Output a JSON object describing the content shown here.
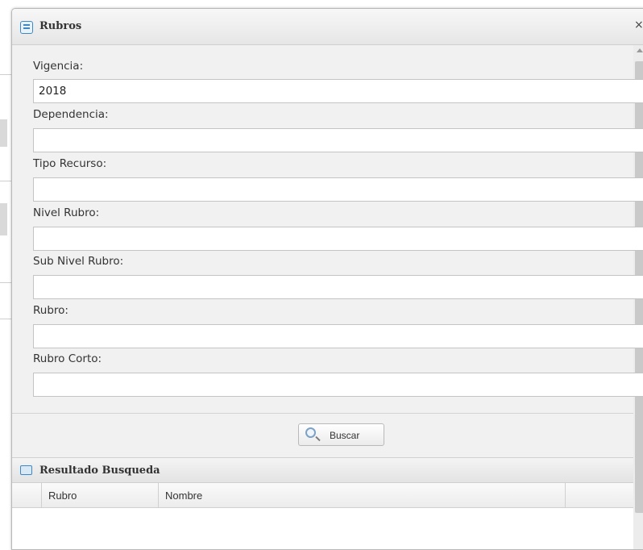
{
  "dialog": {
    "title": "Rubros",
    "close_glyph": "×",
    "icon": "window-icon"
  },
  "form": {
    "fields": [
      {
        "label": "Vigencia:",
        "value": "2018"
      },
      {
        "label": "Dependencia:",
        "value": ""
      },
      {
        "label": "Tipo Recurso:",
        "value": ""
      },
      {
        "label": "Nivel Rubro:",
        "value": ""
      },
      {
        "label": "Sub Nivel Rubro:",
        "value": ""
      },
      {
        "label": "Rubro:",
        "value": ""
      },
      {
        "label": "Rubro Corto:",
        "value": ""
      }
    ]
  },
  "search_button": {
    "label": "Buscar",
    "icon": "search-icon"
  },
  "results": {
    "title": "Resultado Busqueda",
    "icon": "results-panel-icon",
    "columns": [
      "Rubro",
      "Nombre"
    ]
  }
}
